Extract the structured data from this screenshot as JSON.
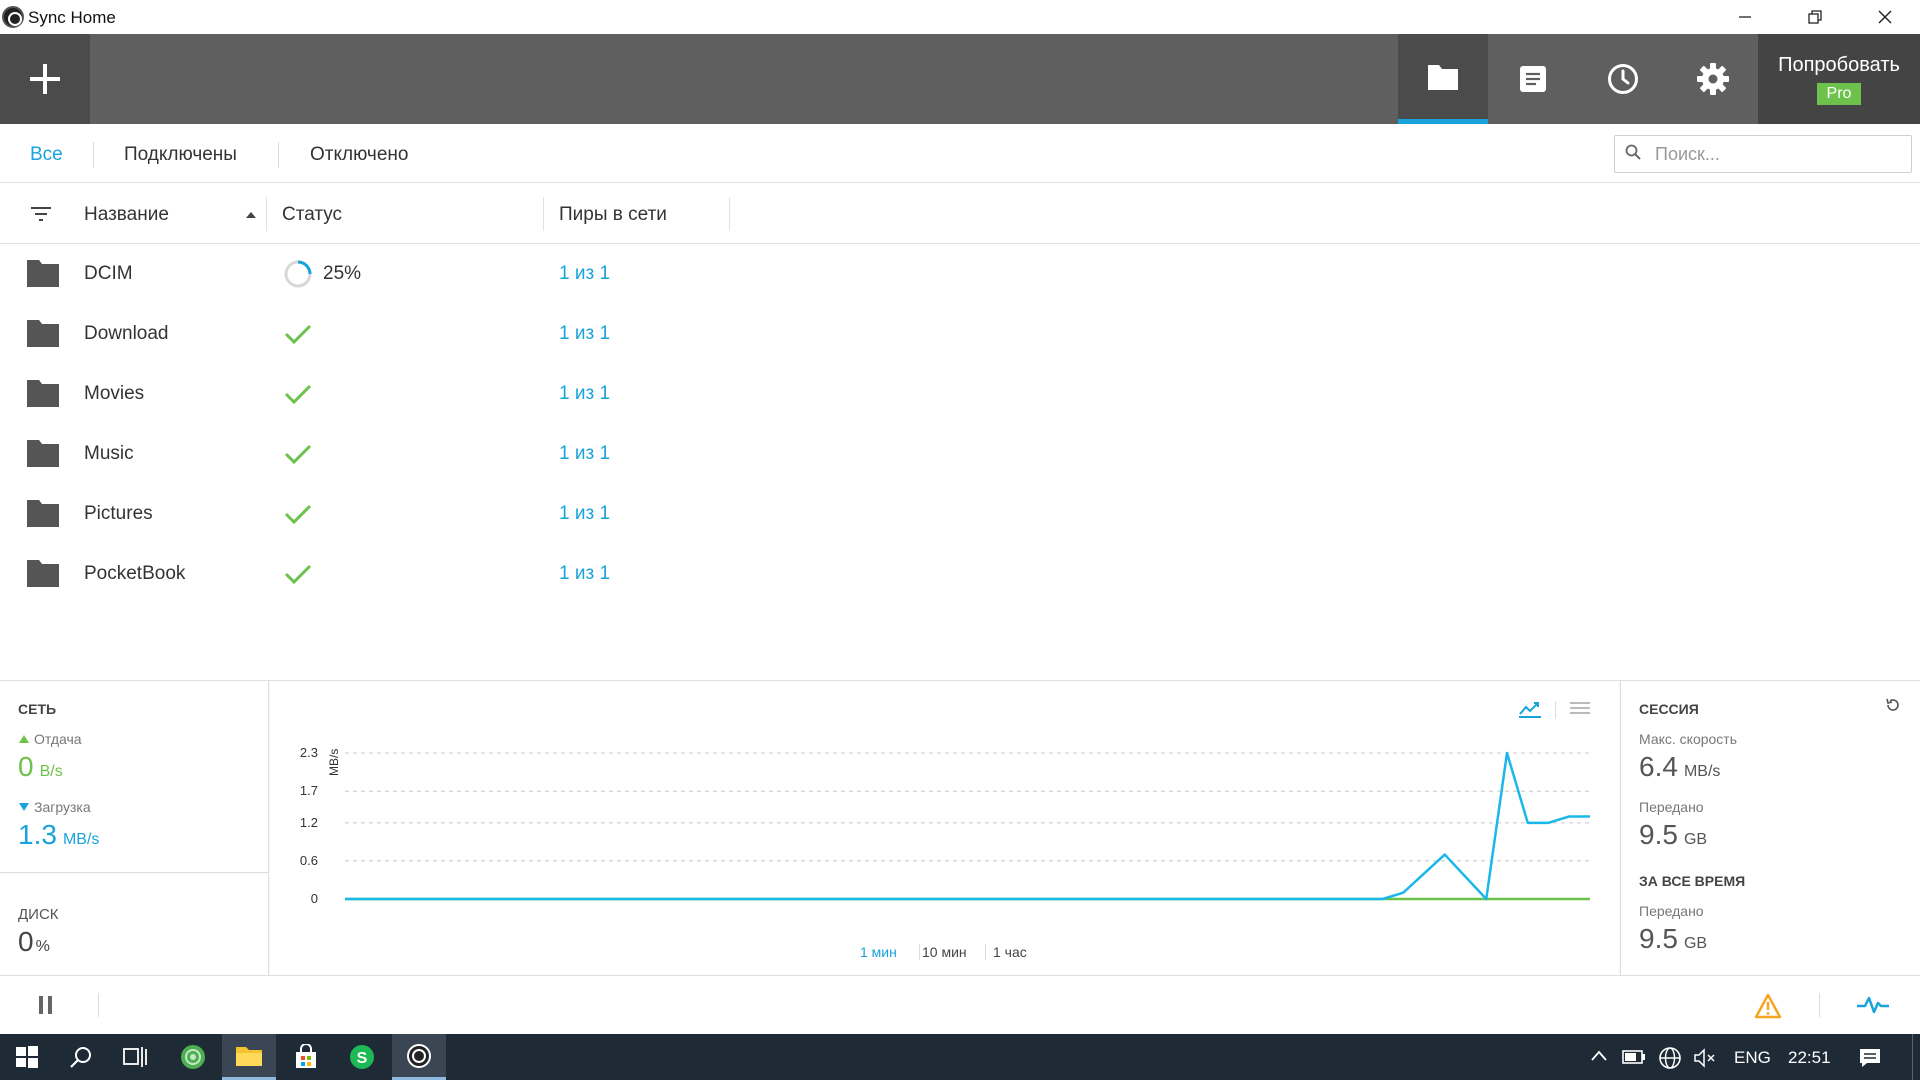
{
  "window": {
    "title": "Sync Home"
  },
  "toolbar": {
    "pro_label": "Попробовать",
    "pro_badge": "Pro"
  },
  "filters": {
    "tabs": [
      "Все",
      "Подключены",
      "Отключено"
    ],
    "active": "Все"
  },
  "search": {
    "placeholder": "Поиск..."
  },
  "table": {
    "columns": [
      "Название",
      "Статус",
      "Пиры в сети"
    ],
    "sorted_by": "Название",
    "rows": [
      {
        "name": "DCIM",
        "status": "syncing",
        "status_text": "25%",
        "progress": 0.25,
        "peers": "1 из 1"
      },
      {
        "name": "Download",
        "status": "synced",
        "status_text": "",
        "peers": "1 из 1"
      },
      {
        "name": "Movies",
        "status": "synced",
        "status_text": "",
        "peers": "1 из 1"
      },
      {
        "name": "Music",
        "status": "synced",
        "status_text": "",
        "peers": "1 из 1"
      },
      {
        "name": "Pictures",
        "status": "synced",
        "status_text": "",
        "peers": "1 из 1"
      },
      {
        "name": "PocketBook",
        "status": "synced",
        "status_text": "",
        "peers": "1 из 1"
      }
    ]
  },
  "network": {
    "title": "СЕТЬ",
    "upload_label": "Отдача",
    "upload_value": "0",
    "upload_unit": "B/s",
    "download_label": "Загрузка",
    "download_value": "1.3",
    "download_unit": "MB/s"
  },
  "disk": {
    "title": "ДИСК",
    "value": "0",
    "unit": "%"
  },
  "chart_controls": {
    "ranges": [
      "1 мин",
      "10 мин",
      "1 час"
    ],
    "active_range": "1 мин"
  },
  "chart_data": {
    "type": "line",
    "ylabel": "MB/s",
    "ylim": [
      0,
      2.3
    ],
    "yticks": [
      "2.3",
      "1.7",
      "1.2",
      "0.6",
      "0"
    ],
    "ytick_values": [
      2.3,
      1.7,
      1.2,
      0.6,
      0
    ],
    "grid": true,
    "series": [
      {
        "color": "#1ab7ea",
        "x": [
          0,
          50,
          51,
          53,
          55,
          56,
          57,
          58,
          59,
          60
        ],
        "values": [
          0,
          0,
          0.1,
          0.7,
          0,
          2.3,
          1.2,
          1.2,
          1.3,
          1.3
        ]
      },
      {
        "color": "#6cc24a",
        "x": [
          0,
          60
        ],
        "values": [
          0,
          0
        ]
      }
    ]
  },
  "session": {
    "title": "СЕССИЯ",
    "max_speed_label": "Макс. скорость",
    "max_speed_value": "6.4",
    "max_speed_unit": "MB/s",
    "transferred_label": "Передано",
    "transferred_value": "9.5",
    "transferred_unit": "GB",
    "alltime_title": "ЗА ВСЕ ВРЕМЯ",
    "alltime_transferred_label": "Передано",
    "alltime_transferred_value": "9.5",
    "alltime_transferred_unit": "GB"
  },
  "taskbar": {
    "lang": "ENG",
    "time": "22:51"
  },
  "colors": {
    "accent": "#1aa2dc",
    "ok": "#6cc24a",
    "warning": "#f5a623",
    "chart_line": "#1ab7ea"
  }
}
